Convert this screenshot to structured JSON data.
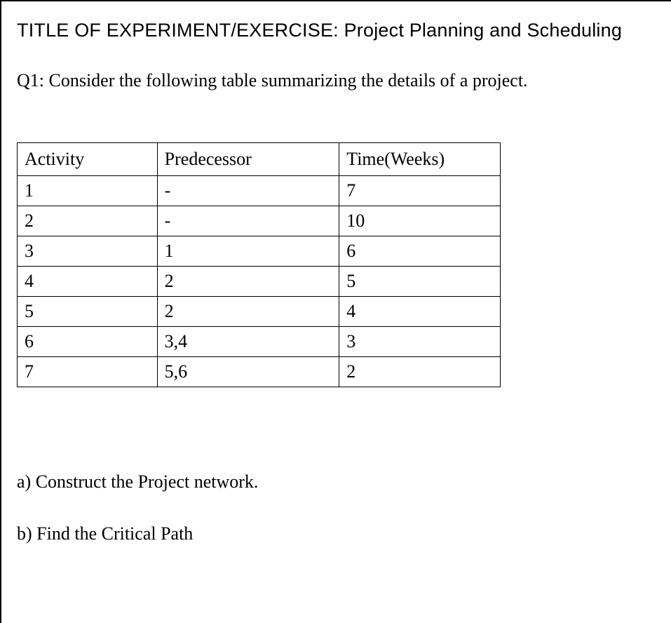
{
  "title": {
    "label": "TITLE OF EXPERIMENT/EXERCISE:  ",
    "value": "Project Planning and Scheduling"
  },
  "question": "Q1: Consider the following table summarizing the details of a project.",
  "table": {
    "headers": {
      "activity": "Activity",
      "predecessor": "Predecessor",
      "time": "Time(Weeks)"
    },
    "rows": [
      {
        "activity": "1",
        "predecessor": "-",
        "time": "7"
      },
      {
        "activity": "2",
        "predecessor": "-",
        "time": "10"
      },
      {
        "activity": "3",
        "predecessor": "1",
        "time": "6"
      },
      {
        "activity": "4",
        "predecessor": "2",
        "time": "5"
      },
      {
        "activity": "5",
        "predecessor": "2",
        "time": "4"
      },
      {
        "activity": "6",
        "predecessor": "3,4",
        "time": "3"
      },
      {
        "activity": "7",
        "predecessor": "5,6",
        "time": "2"
      }
    ]
  },
  "sub_questions": {
    "a": "a) Construct the Project network.",
    "b": "b) Find the Critical Path"
  }
}
